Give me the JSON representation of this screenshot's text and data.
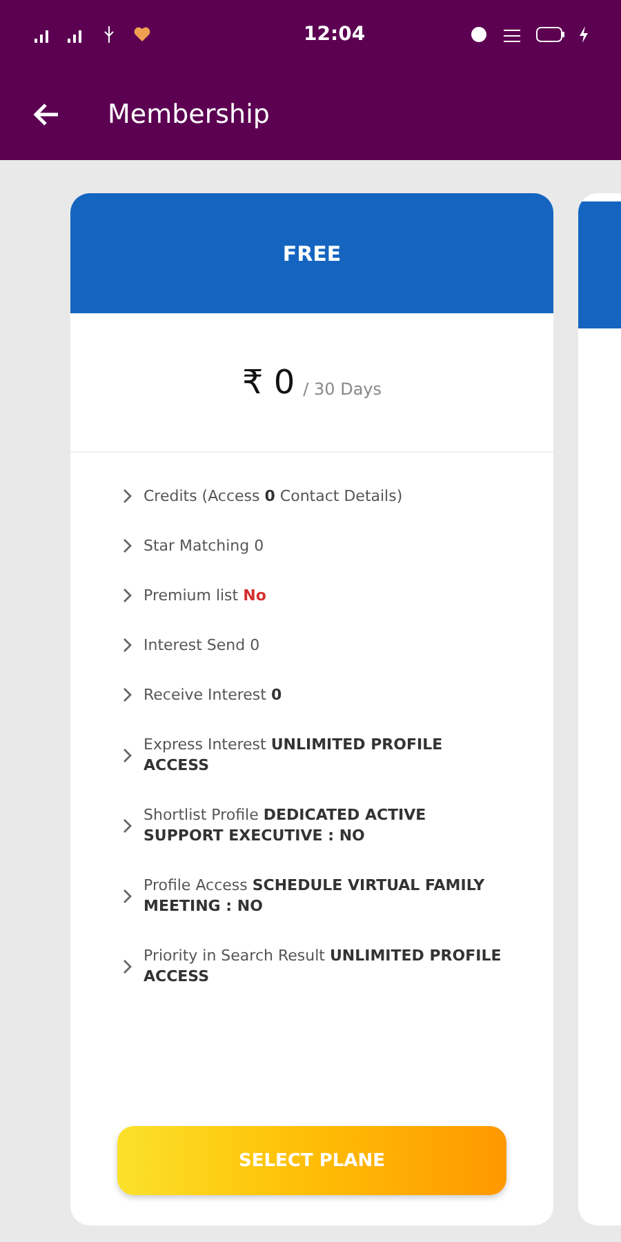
{
  "status_bar": {
    "time": "12:04"
  },
  "app_bar": {
    "title": "Membership"
  },
  "plans": [
    {
      "name": "FREE",
      "price": "₹ 0",
      "period": "/ 30 Days",
      "features": [
        {
          "text": "Credits (Access **0** Contact Details)",
          "kind": "plain"
        },
        {
          "text": "Star Matching 0",
          "kind": "plain"
        },
        {
          "text": "Premium list **No**",
          "kind": "alert"
        },
        {
          "text": "Interest Send 0",
          "kind": "plain"
        },
        {
          "text": "Receive Interest **0**",
          "kind": "plain"
        },
        {
          "text": "Express Interest **UNLIMITED PROFILE ACCESS**",
          "kind": "plain"
        },
        {
          "text": "Shortlist Profile **DEDICATED ACTIVE SUPPORT EXECUTIVE : NO**",
          "kind": "plain"
        },
        {
          "text": "Profile Access **SCHEDULE VIRTUAL FAMILY MEETING : NO**",
          "kind": "plain"
        },
        {
          "text": "Priority in Search Result **UNLIMITED PROFILE ACCESS**",
          "kind": "plain"
        }
      ],
      "button": "SELECT PLANE"
    }
  ],
  "next_plan": {
    "kind": "partial"
  }
}
